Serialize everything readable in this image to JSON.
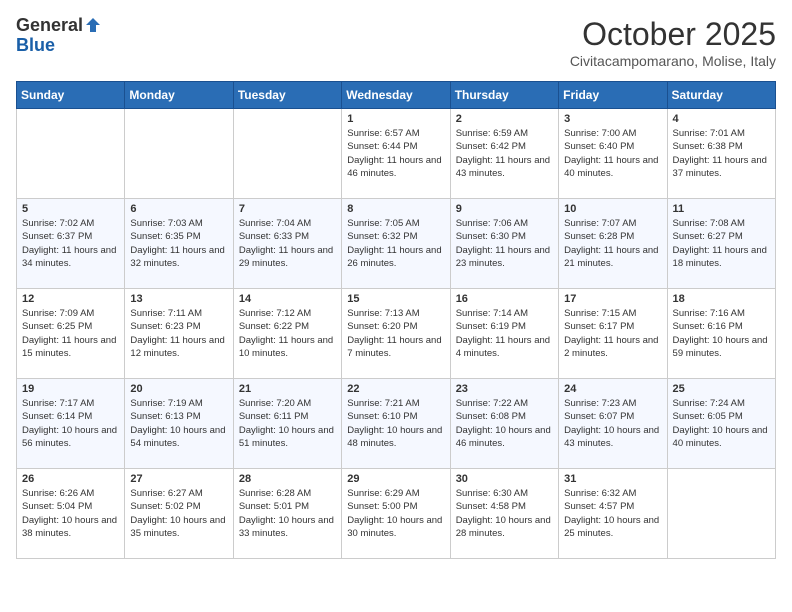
{
  "logo": {
    "general": "General",
    "blue": "Blue"
  },
  "title": "October 2025",
  "location": "Civitacampomarano, Molise, Italy",
  "days_of_week": [
    "Sunday",
    "Monday",
    "Tuesday",
    "Wednesday",
    "Thursday",
    "Friday",
    "Saturday"
  ],
  "weeks": [
    [
      {
        "day": "",
        "info": ""
      },
      {
        "day": "",
        "info": ""
      },
      {
        "day": "",
        "info": ""
      },
      {
        "day": "1",
        "info": "Sunrise: 6:57 AM\nSunset: 6:44 PM\nDaylight: 11 hours and 46 minutes."
      },
      {
        "day": "2",
        "info": "Sunrise: 6:59 AM\nSunset: 6:42 PM\nDaylight: 11 hours and 43 minutes."
      },
      {
        "day": "3",
        "info": "Sunrise: 7:00 AM\nSunset: 6:40 PM\nDaylight: 11 hours and 40 minutes."
      },
      {
        "day": "4",
        "info": "Sunrise: 7:01 AM\nSunset: 6:38 PM\nDaylight: 11 hours and 37 minutes."
      }
    ],
    [
      {
        "day": "5",
        "info": "Sunrise: 7:02 AM\nSunset: 6:37 PM\nDaylight: 11 hours and 34 minutes."
      },
      {
        "day": "6",
        "info": "Sunrise: 7:03 AM\nSunset: 6:35 PM\nDaylight: 11 hours and 32 minutes."
      },
      {
        "day": "7",
        "info": "Sunrise: 7:04 AM\nSunset: 6:33 PM\nDaylight: 11 hours and 29 minutes."
      },
      {
        "day": "8",
        "info": "Sunrise: 7:05 AM\nSunset: 6:32 PM\nDaylight: 11 hours and 26 minutes."
      },
      {
        "day": "9",
        "info": "Sunrise: 7:06 AM\nSunset: 6:30 PM\nDaylight: 11 hours and 23 minutes."
      },
      {
        "day": "10",
        "info": "Sunrise: 7:07 AM\nSunset: 6:28 PM\nDaylight: 11 hours and 21 minutes."
      },
      {
        "day": "11",
        "info": "Sunrise: 7:08 AM\nSunset: 6:27 PM\nDaylight: 11 hours and 18 minutes."
      }
    ],
    [
      {
        "day": "12",
        "info": "Sunrise: 7:09 AM\nSunset: 6:25 PM\nDaylight: 11 hours and 15 minutes."
      },
      {
        "day": "13",
        "info": "Sunrise: 7:11 AM\nSunset: 6:23 PM\nDaylight: 11 hours and 12 minutes."
      },
      {
        "day": "14",
        "info": "Sunrise: 7:12 AM\nSunset: 6:22 PM\nDaylight: 11 hours and 10 minutes."
      },
      {
        "day": "15",
        "info": "Sunrise: 7:13 AM\nSunset: 6:20 PM\nDaylight: 11 hours and 7 minutes."
      },
      {
        "day": "16",
        "info": "Sunrise: 7:14 AM\nSunset: 6:19 PM\nDaylight: 11 hours and 4 minutes."
      },
      {
        "day": "17",
        "info": "Sunrise: 7:15 AM\nSunset: 6:17 PM\nDaylight: 11 hours and 2 minutes."
      },
      {
        "day": "18",
        "info": "Sunrise: 7:16 AM\nSunset: 6:16 PM\nDaylight: 10 hours and 59 minutes."
      }
    ],
    [
      {
        "day": "19",
        "info": "Sunrise: 7:17 AM\nSunset: 6:14 PM\nDaylight: 10 hours and 56 minutes."
      },
      {
        "day": "20",
        "info": "Sunrise: 7:19 AM\nSunset: 6:13 PM\nDaylight: 10 hours and 54 minutes."
      },
      {
        "day": "21",
        "info": "Sunrise: 7:20 AM\nSunset: 6:11 PM\nDaylight: 10 hours and 51 minutes."
      },
      {
        "day": "22",
        "info": "Sunrise: 7:21 AM\nSunset: 6:10 PM\nDaylight: 10 hours and 48 minutes."
      },
      {
        "day": "23",
        "info": "Sunrise: 7:22 AM\nSunset: 6:08 PM\nDaylight: 10 hours and 46 minutes."
      },
      {
        "day": "24",
        "info": "Sunrise: 7:23 AM\nSunset: 6:07 PM\nDaylight: 10 hours and 43 minutes."
      },
      {
        "day": "25",
        "info": "Sunrise: 7:24 AM\nSunset: 6:05 PM\nDaylight: 10 hours and 40 minutes."
      }
    ],
    [
      {
        "day": "26",
        "info": "Sunrise: 6:26 AM\nSunset: 5:04 PM\nDaylight: 10 hours and 38 minutes."
      },
      {
        "day": "27",
        "info": "Sunrise: 6:27 AM\nSunset: 5:02 PM\nDaylight: 10 hours and 35 minutes."
      },
      {
        "day": "28",
        "info": "Sunrise: 6:28 AM\nSunset: 5:01 PM\nDaylight: 10 hours and 33 minutes."
      },
      {
        "day": "29",
        "info": "Sunrise: 6:29 AM\nSunset: 5:00 PM\nDaylight: 10 hours and 30 minutes."
      },
      {
        "day": "30",
        "info": "Sunrise: 6:30 AM\nSunset: 4:58 PM\nDaylight: 10 hours and 28 minutes."
      },
      {
        "day": "31",
        "info": "Sunrise: 6:32 AM\nSunset: 4:57 PM\nDaylight: 10 hours and 25 minutes."
      },
      {
        "day": "",
        "info": ""
      }
    ]
  ]
}
